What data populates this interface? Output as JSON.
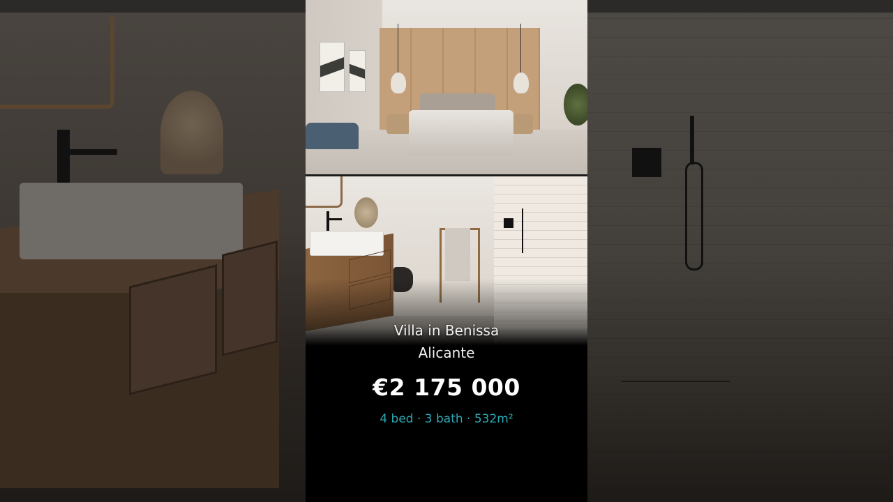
{
  "listing": {
    "property_type_location": "Villa in Benissa",
    "region": "Alicante",
    "price": "€2 175 000",
    "specs": "4 bed · 3 bath · 532m²"
  },
  "colors": {
    "page_background": "#1a1816",
    "panel_background": "#000000",
    "price_text": "#ffffff",
    "specs_accent": "#2ea7b5"
  }
}
